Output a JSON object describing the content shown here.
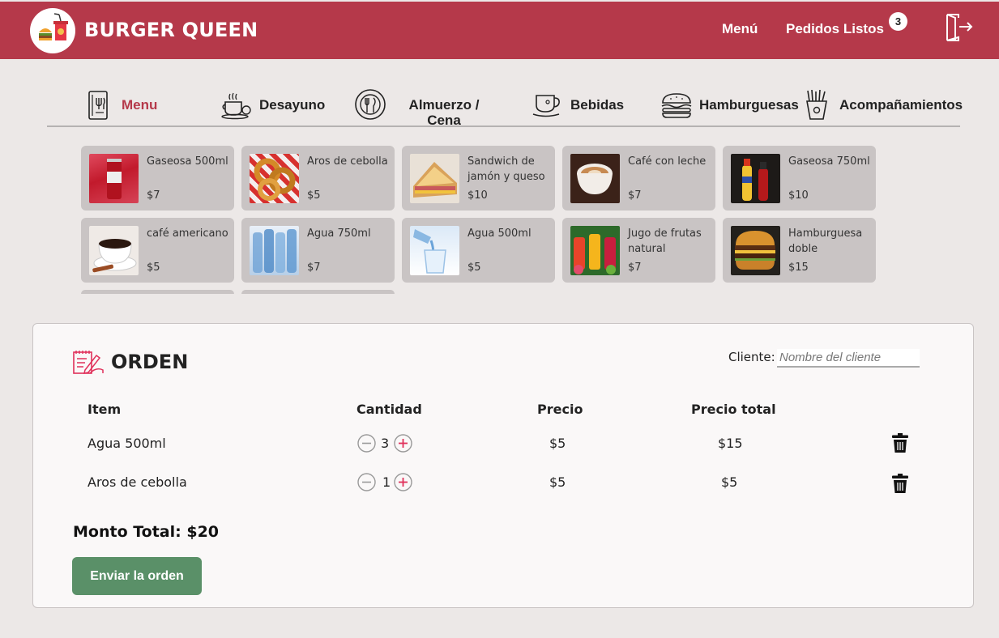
{
  "header": {
    "brand": "BURGER QUEEN",
    "nav_menu": "Menú",
    "nav_orders": "Pedidos Listos",
    "orders_badge": "3",
    "logo_icon": "burger-drink-icon",
    "logout_icon": "logout-door-icon",
    "bar_color": "#b5394a"
  },
  "tabs": [
    {
      "label": "Menu",
      "icon": "menu-book-icon",
      "active": true
    },
    {
      "label": "Desayuno",
      "icon": "breakfast-coffee-icon",
      "active": false
    },
    {
      "label": "Almuerzo / Cena",
      "icon": "plate-cutlery-icon",
      "active": false
    },
    {
      "label": "Bebidas",
      "icon": "coffee-cup-icon",
      "active": false
    },
    {
      "label": "Hamburguesas",
      "icon": "burger-icon",
      "active": false
    },
    {
      "label": "Acompañamientos",
      "icon": "fries-icon",
      "active": false
    }
  ],
  "products": [
    {
      "name": "Gaseosa 500ml",
      "price": "$7"
    },
    {
      "name": "Aros de cebolla",
      "price": "$5"
    },
    {
      "name": "Sandwich de jamón y queso",
      "price": "$10"
    },
    {
      "name": "Café con leche",
      "price": "$7"
    },
    {
      "name": "Gaseosa 750ml",
      "price": "$10"
    },
    {
      "name": "café americano",
      "price": "$5"
    },
    {
      "name": "Agua 750ml",
      "price": "$7"
    },
    {
      "name": "Agua 500ml",
      "price": "$5"
    },
    {
      "name": "Jugo de frutas natural",
      "price": "$7"
    },
    {
      "name": "Hamburguesa doble",
      "price": "$15"
    }
  ],
  "order": {
    "title": "ORDEN",
    "title_icon": "order-notepad-icon",
    "client_label": "Cliente:",
    "client_placeholder": "Nombre del cliente",
    "columns": [
      "Item",
      "Cantidad",
      "Precio",
      "Precio total"
    ],
    "rows": [
      {
        "item": "Agua 500ml",
        "qty": "3",
        "price": "$5",
        "total": "$15"
      },
      {
        "item": "Aros de cebolla",
        "qty": "1",
        "price": "$5",
        "total": "$5"
      }
    ],
    "total_label": "Monto Total: $20",
    "send_label": "Enviar la orden",
    "accent": "#e0305a",
    "send_color": "#5a9068"
  }
}
